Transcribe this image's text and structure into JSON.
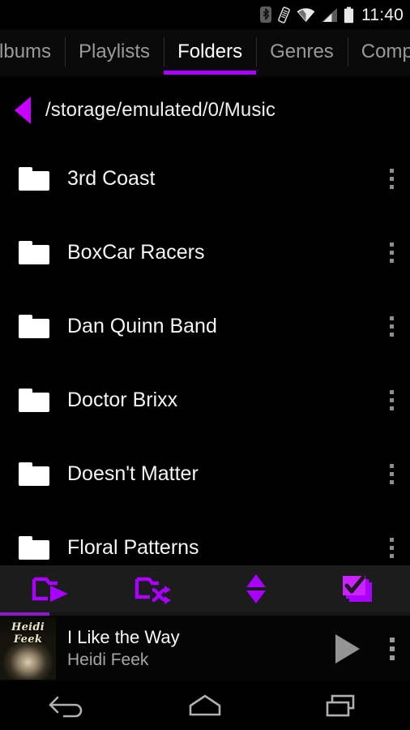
{
  "statusbar": {
    "clock": "11:40",
    "icons": [
      "bluetooth-icon",
      "vibrate-icon",
      "wifi-icon",
      "cellular-signal-icon",
      "battery-icon"
    ]
  },
  "tabs": {
    "items": [
      {
        "label": "Albums",
        "active": false,
        "clipped": true
      },
      {
        "label": "Playlists",
        "active": false,
        "clipped": false
      },
      {
        "label": "Folders",
        "active": true,
        "clipped": false
      },
      {
        "label": "Genres",
        "active": false,
        "clipped": false
      },
      {
        "label": "Compos",
        "active": false,
        "clipped": true
      }
    ],
    "active_index": 2,
    "indicator_color": "#aa00ff"
  },
  "path_bar": {
    "back_icon": "triangle-left-icon",
    "path": "/storage/emulated/0/Music"
  },
  "folder_list": {
    "overflow_icon": "kebab-menu-icon",
    "folder_icon": "folder-icon",
    "items": [
      {
        "name": "3rd Coast"
      },
      {
        "name": "BoxCar Racers"
      },
      {
        "name": "Dan Quinn Band"
      },
      {
        "name": "Doctor Brixx"
      },
      {
        "name": "Doesn't Matter"
      },
      {
        "name": "Floral Patterns"
      }
    ]
  },
  "toolbar": {
    "accent_color": "#aa00ff",
    "buttons": [
      {
        "name": "play-folder-button",
        "icon": "folder-play-icon"
      },
      {
        "name": "shuffle-folder-button",
        "icon": "folder-shuffle-icon"
      },
      {
        "name": "sort-button",
        "icon": "sort-up-down-icon"
      },
      {
        "name": "select-multiple-button",
        "icon": "multi-select-check-icon"
      }
    ]
  },
  "progress": {
    "percent": 12,
    "color": "#8e17cf"
  },
  "now_playing": {
    "album_art_text": "Heidi Feek",
    "title": "I Like the Way",
    "artist": "Heidi Feek",
    "play_icon": "play-icon",
    "overflow_icon": "kebab-menu-icon"
  },
  "navbar": {
    "buttons": [
      {
        "name": "nav-back-button",
        "icon": "back-arrow-icon"
      },
      {
        "name": "nav-home-button",
        "icon": "home-icon"
      },
      {
        "name": "nav-recents-button",
        "icon": "recents-icon"
      }
    ]
  }
}
